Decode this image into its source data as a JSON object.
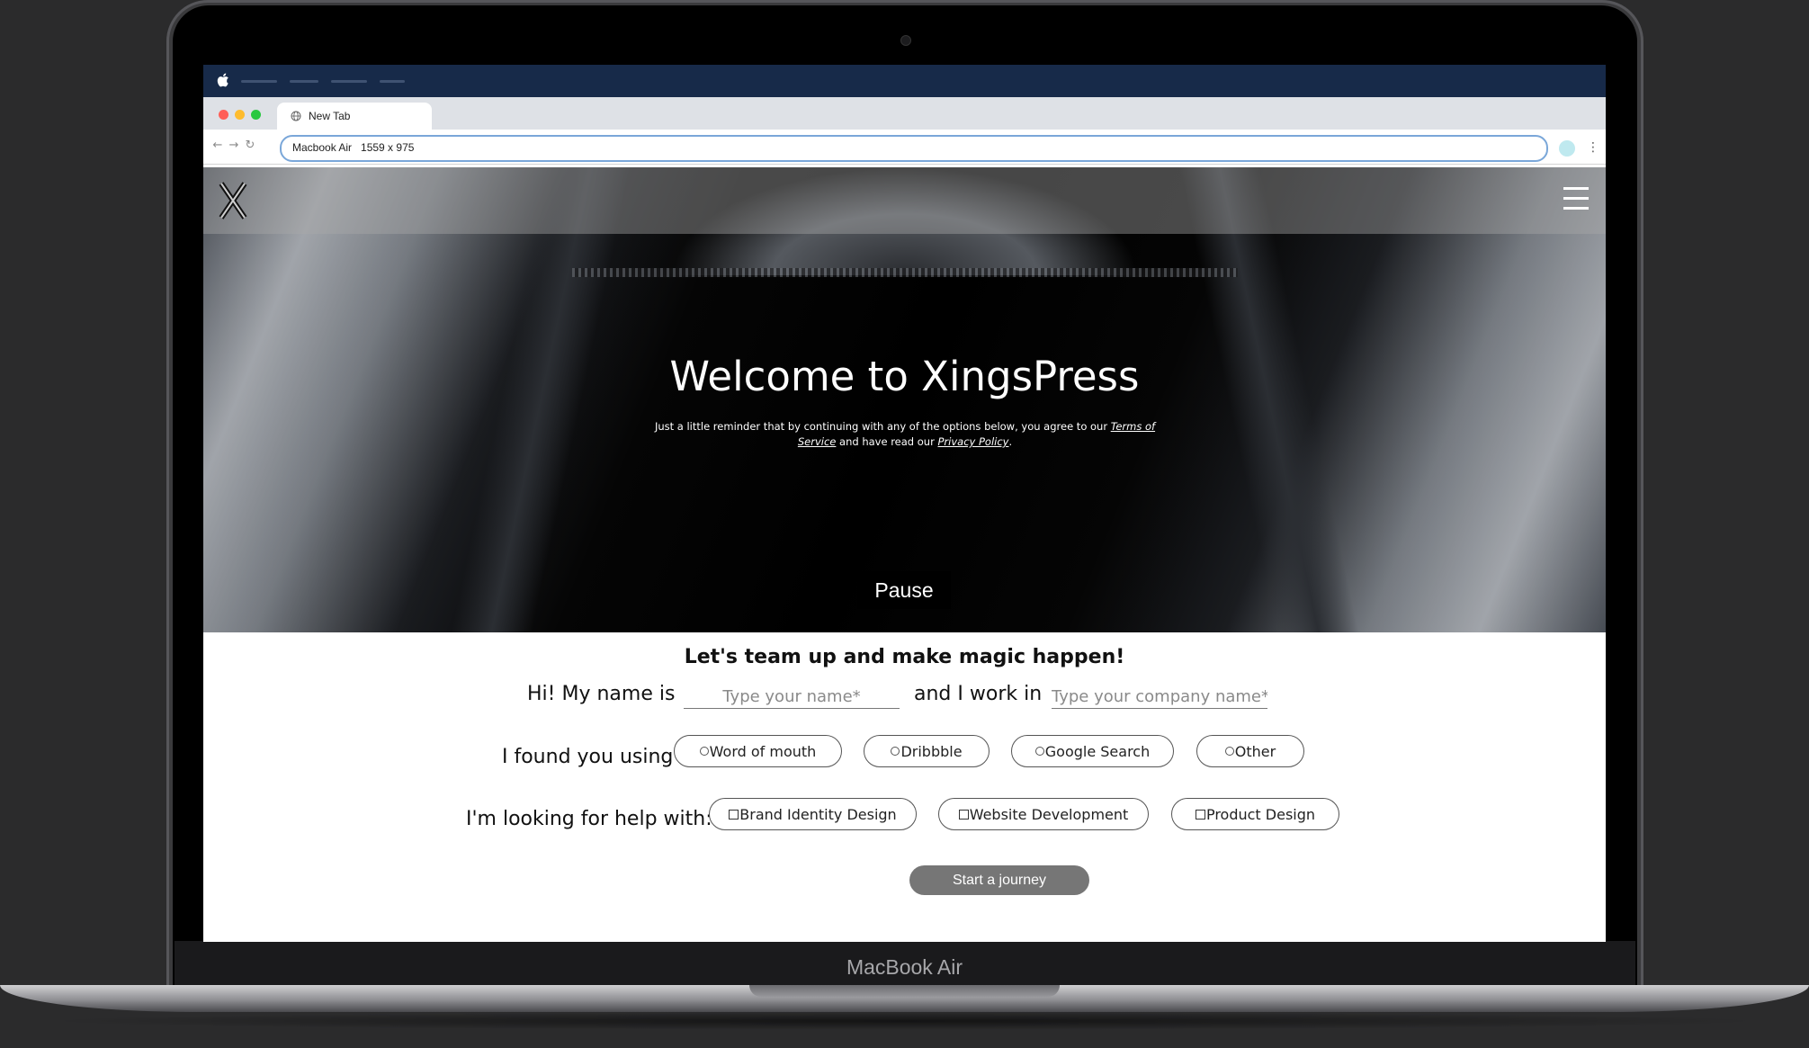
{
  "device": {
    "model_label": "MacBook Air"
  },
  "menubar": {
    "icon": "apple-icon"
  },
  "browser": {
    "tab_title": "New Tab",
    "address": "Macbook Air   1559 x 975",
    "traffic_light_colors": [
      "#ff5f57",
      "#febc2e",
      "#28c840"
    ]
  },
  "site": {
    "nav": {
      "logo": "X",
      "menu_icon": "hamburger-icon"
    },
    "hero": {
      "title": "Welcome to XingsPress",
      "note_prefix": "Just a little reminder that by continuing with any of the options below, you agree to our ",
      "terms_link": "Terms of Service",
      "note_middle": " and have read our ",
      "privacy_link": "Privacy Policy",
      "note_suffix": ".",
      "pause_label": "Pause"
    },
    "form": {
      "heading": "Let's team up and make magic happen!",
      "name_prefix": "Hi! My name is",
      "name_placeholder": "Type your name*",
      "company_prefix": "and I work in",
      "company_placeholder": "Type your company name*",
      "source_label": "I found you using",
      "source_options": [
        "Word of mouth",
        "Dribbble",
        "Google Search",
        "Other"
      ],
      "help_label": "I'm looking for help with:",
      "help_options": [
        "Brand Identity Design",
        "Website Development",
        "Product Design"
      ],
      "submit_label": "Start a journey"
    }
  }
}
